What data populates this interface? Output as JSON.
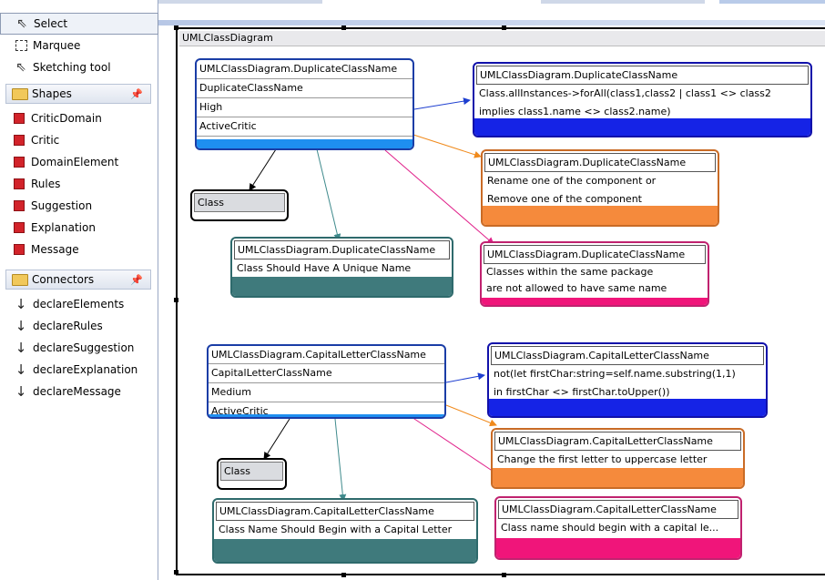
{
  "palette": {
    "tools": [
      {
        "label": "Select",
        "icon": "pointer-icon"
      },
      {
        "label": "Marquee",
        "icon": "marquee-icon"
      },
      {
        "label": "Sketching tool",
        "icon": "sketch-pointer-icon"
      }
    ],
    "shapes_drawer": "Shapes",
    "shapes": [
      "CriticDomain",
      "Critic",
      "DomainElement",
      "Rules",
      "Suggestion",
      "Explanation",
      "Message"
    ],
    "connectors_drawer": "Connectors",
    "connectors": [
      "declareElements",
      "declareRules",
      "declareSuggestion",
      "declareExplanation",
      "declareMessage"
    ],
    "pin_glyph": "📌"
  },
  "diagram": {
    "title": "UMLClassDiagram",
    "critic1": {
      "name": "UMLClassDiagram.DuplicateClassName",
      "rows": [
        "DuplicateClassName",
        "High",
        "ActiveCritic"
      ],
      "domain": "Class",
      "rules": {
        "title": "UMLClassDiagram.DuplicateClassName",
        "lines": [
          "Class.allInstances->forAll(class1,class2 | class1 <> class2",
          "implies class1.name <> class2.name)"
        ]
      },
      "suggestion": {
        "title": "UMLClassDiagram.DuplicateClassName",
        "lines": [
          "Rename one of the component or",
          "Remove one of the component"
        ]
      },
      "explanation": {
        "title": "UMLClassDiagram.DuplicateClassName",
        "lines": [
          "Class Should Have A Unique Name"
        ]
      },
      "message": {
        "title": "UMLClassDiagram.DuplicateClassName",
        "lines": [
          "Classes within the same package",
          "are not allowed to have same name"
        ]
      }
    },
    "critic2": {
      "name": "UMLClassDiagram.CapitalLetterClassName",
      "rows": [
        "CapitalLetterClassName",
        "Medium",
        "ActiveCritic"
      ],
      "domain": "Class",
      "rules": {
        "title": "UMLClassDiagram.CapitalLetterClassName",
        "lines": [
          "not(let firstChar:string=self.name.substring(1,1)",
          "in firstChar <> firstChar.toUpper())"
        ]
      },
      "suggestion": {
        "title": "UMLClassDiagram.CapitalLetterClassName",
        "lines": [
          "Change the first letter to uppercase letter"
        ]
      },
      "explanation": {
        "title": "UMLClassDiagram.CapitalLetterClassName",
        "lines": [
          "Class Name Should Begin with a Capital Letter"
        ]
      },
      "message": {
        "title": "UMLClassDiagram.CapitalLetterClassName",
        "lines": [
          "Class name should begin with a capital le..."
        ]
      }
    }
  },
  "colors": {
    "critic_border": "#1a3da6",
    "critic_fill": "#1e8ff0",
    "rules_fill": "#1523e6",
    "suggestion_fill": "#f58a3c",
    "explanation_fill": "#3f7a7c",
    "message_fill": "#f0157a",
    "rules_line": "#1e3fd0",
    "suggestion_line": "#f08a1c",
    "explanation_line": "#3f8a8c",
    "message_line": "#e0208a",
    "domain_line": "#000000"
  }
}
